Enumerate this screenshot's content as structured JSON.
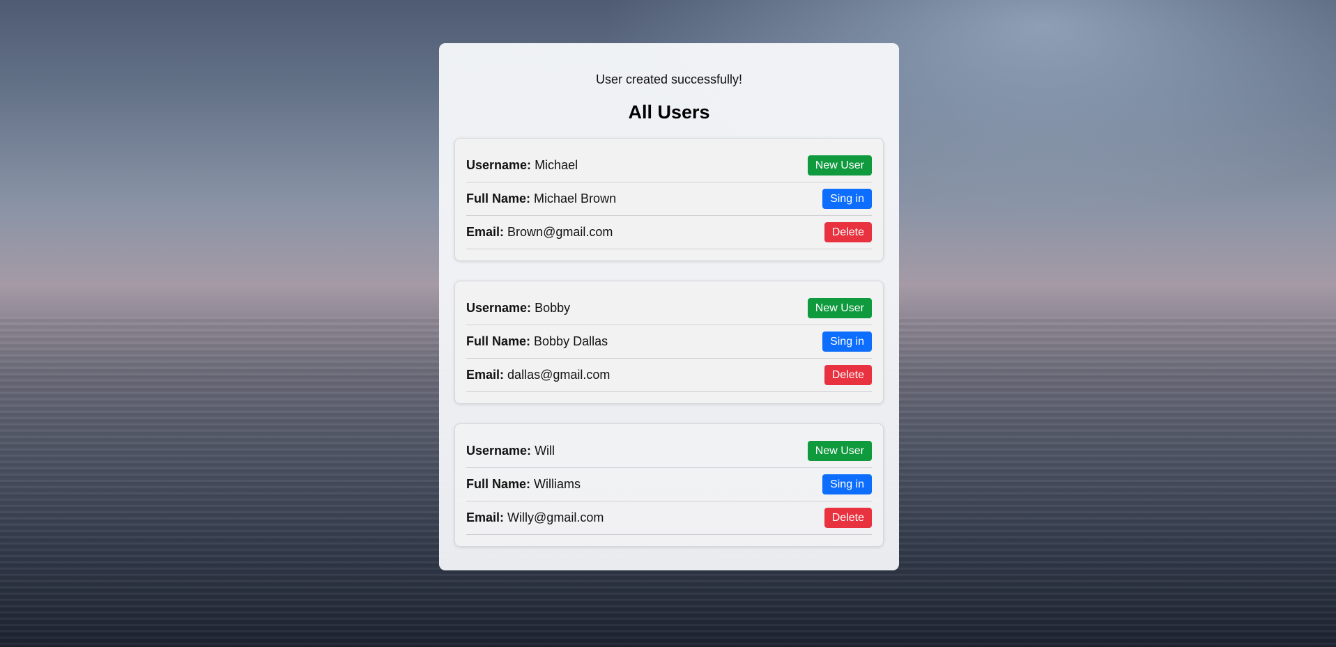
{
  "status_message": "User created successfully!",
  "page_title": "All Users",
  "labels": {
    "username": "Username:",
    "full_name": "Full Name:",
    "email": "Email:"
  },
  "buttons": {
    "new_user": "New User",
    "sign_in": "Sing in",
    "delete": "Delete"
  },
  "users": [
    {
      "username": "Michael",
      "full_name": "Michael Brown",
      "email": "Brown@gmail.com"
    },
    {
      "username": "Bobby",
      "full_name": "Bobby Dallas",
      "email": "dallas@gmail.com"
    },
    {
      "username": "Will",
      "full_name": "Williams",
      "email": "Willy@gmail.com"
    }
  ],
  "colors": {
    "new_user_button": "#0f9a3e",
    "sign_in_button": "#0d6efd",
    "delete_button": "#e8323f"
  }
}
